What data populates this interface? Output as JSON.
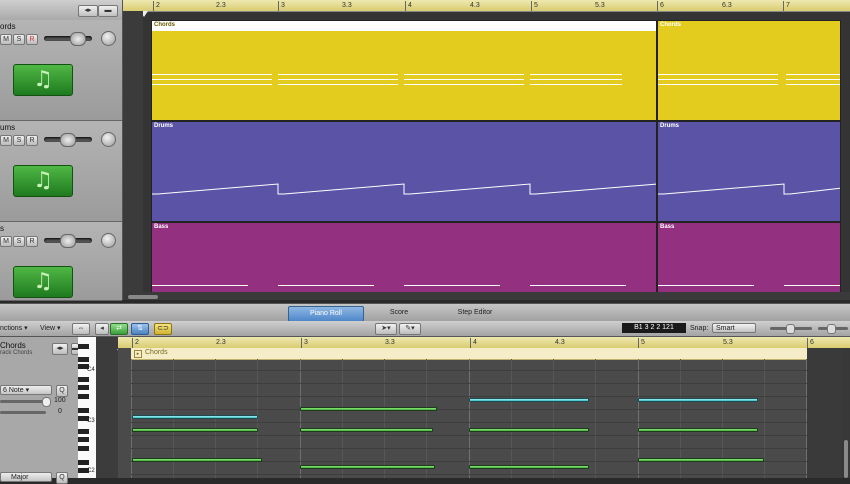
{
  "arrange": {
    "ruler": [
      "2",
      "2.3",
      "3",
      "3.3",
      "4",
      "4.3",
      "5",
      "5.3",
      "6",
      "6.3",
      "7"
    ],
    "tracks": [
      {
        "name": "ords",
        "region_name": "Chords",
        "color": "#e3cc1e"
      },
      {
        "name": "ums",
        "region_name": "Drums",
        "color": "#5b54a6"
      },
      {
        "name": "s",
        "region_name": "Bass",
        "color": "#93307f"
      }
    ],
    "track_buttons": {
      "mute": "M",
      "solo": "S",
      "record": "R"
    }
  },
  "editor": {
    "tabs": [
      "Piano Roll",
      "Score",
      "Step Editor"
    ],
    "active_tab": "Piano Roll",
    "toolbar": {
      "functions": "nctions ▾",
      "view": "View ▾",
      "position": "B1   3 2 2 121",
      "snap_label": "Snap:",
      "snap_value": "Smart"
    },
    "left_panel": {
      "track_title": "Chords",
      "track_subtitle": "rack Chords",
      "quantize": "6 Note",
      "quantize_q": "Q",
      "value_100": "100",
      "value_0": "0",
      "scale": "Major"
    },
    "piano_labels": [
      "C4",
      "C3",
      "C2"
    ],
    "ruler": [
      "2",
      "2.3",
      "3",
      "3.3",
      "4",
      "4.3",
      "5",
      "5.3",
      "6"
    ],
    "region_label": "Chords"
  },
  "colors": {
    "chords": "#e3cc1e",
    "drums": "#5b54a6",
    "bass": "#93307f",
    "note_green": "#4fbf4a",
    "note_cyan": "#44c2c8",
    "ruler": "#e2d58a"
  }
}
